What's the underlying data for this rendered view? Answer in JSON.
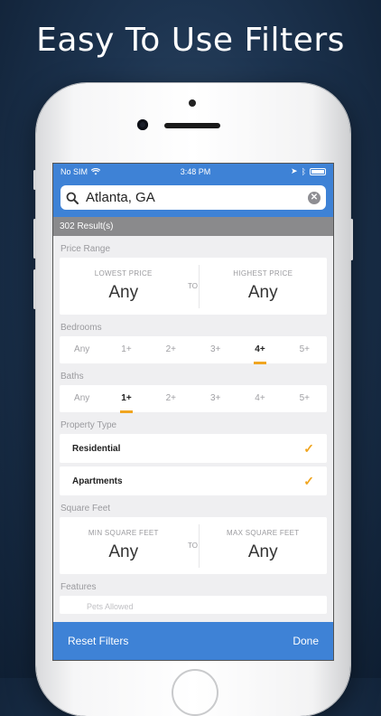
{
  "headline": "Easy To Use Filters",
  "status": {
    "carrier": "No SIM",
    "time": "3:48 PM"
  },
  "search": {
    "value": "Atlanta, GA",
    "placeholder": ""
  },
  "results": "302 Result(s)",
  "price": {
    "section": "Price Range",
    "low_label": "LOWEST PRICE",
    "low_value": "Any",
    "to": "TO",
    "high_label": "HIGHEST PRICE",
    "high_value": "Any"
  },
  "bedrooms": {
    "section": "Bedrooms",
    "options": [
      "Any",
      "1+",
      "2+",
      "3+",
      "4+",
      "5+"
    ],
    "selected": "4+"
  },
  "baths": {
    "section": "Baths",
    "options": [
      "Any",
      "1+",
      "2+",
      "3+",
      "4+",
      "5+"
    ],
    "selected": "1+"
  },
  "property_type": {
    "section": "Property Type",
    "items": [
      "Residential",
      "Apartments"
    ]
  },
  "square_feet": {
    "section": "Square Feet",
    "min_label": "MIN SQUARE FEET",
    "min_value": "Any",
    "to": "TO",
    "max_label": "MAX SQUARE FEET",
    "max_value": "Any"
  },
  "features": {
    "section": "Features",
    "first_item": "Pets Allowed"
  },
  "footer": {
    "reset": "Reset Filters",
    "done": "Done"
  },
  "colors": {
    "accent": "#3e82d6",
    "highlight": "#f0a520"
  }
}
